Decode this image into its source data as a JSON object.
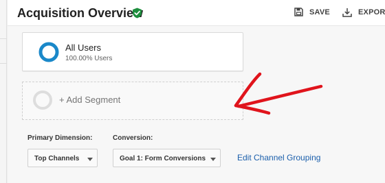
{
  "header": {
    "title": "Acquisition Overview",
    "actions": [
      {
        "label": "SAVE",
        "icon": "save-icon"
      },
      {
        "label": "EXPORT",
        "icon": "export-icon"
      }
    ]
  },
  "segments": {
    "active": {
      "name": "All Users",
      "detail": "100.00% Users"
    },
    "add_label": "+ Add Segment"
  },
  "controls": {
    "primary_dimension": {
      "label": "Primary Dimension:",
      "value": "Top Channels"
    },
    "conversion": {
      "label": "Conversion:",
      "value": "Goal 1: Form Conversions"
    },
    "edit_link": "Edit Channel Grouping"
  },
  "colors": {
    "segment_donut": "#1a88c9",
    "verified_badge": "#1e8e3e",
    "annotation_arrow": "#e0141c",
    "link": "#1a5eab"
  }
}
